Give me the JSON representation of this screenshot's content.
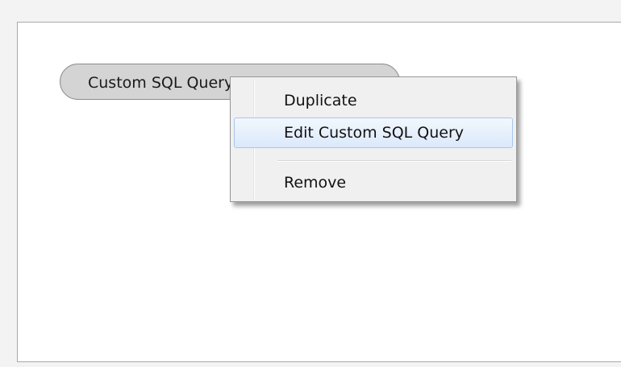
{
  "canvas": {
    "table_pill_label": "Custom SQL Query"
  },
  "context_menu": {
    "items": [
      {
        "label": "Duplicate"
      },
      {
        "label": "Edit Custom SQL Query",
        "highlighted": true
      },
      {
        "label": "Remove"
      }
    ]
  }
}
